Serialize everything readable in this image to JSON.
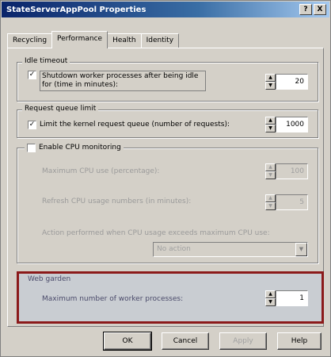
{
  "window": {
    "title": "StateServerAppPool Properties",
    "help_glyph": "?",
    "close_glyph": "X"
  },
  "tabs": [
    {
      "label": "Recycling"
    },
    {
      "label": "Performance"
    },
    {
      "label": "Health"
    },
    {
      "label": "Identity"
    }
  ],
  "idle_timeout": {
    "legend": "Idle timeout",
    "checkbox_label": "Shutdown worker processes after being idle for (time in minutes):",
    "checked": true,
    "value": "20"
  },
  "request_queue": {
    "legend": "Request queue limit",
    "checkbox_label": "Limit the kernel request queue (number of requests):",
    "checked": true,
    "value": "1000"
  },
  "cpu": {
    "checkbox_label": "Enable CPU monitoring",
    "checked": false,
    "max_cpu_label": "Maximum CPU use (percentage):",
    "max_cpu_value": "100",
    "refresh_label": "Refresh CPU usage numbers (in minutes):",
    "refresh_value": "5",
    "action_label": "Action performed when CPU usage exceeds maximum CPU use:",
    "action_value": "No action"
  },
  "web_garden": {
    "legend": "Web garden",
    "max_processes_label": "Maximum number of worker processes:",
    "max_processes_value": "1"
  },
  "buttons": {
    "ok": "OK",
    "cancel": "Cancel",
    "apply": "Apply",
    "help": "Help"
  },
  "glyphs": {
    "check": "✓",
    "up": "▲",
    "down": "▼"
  },
  "colors": {
    "highlight_border": "#8b1a1a",
    "title_bar": "#0a246a"
  }
}
